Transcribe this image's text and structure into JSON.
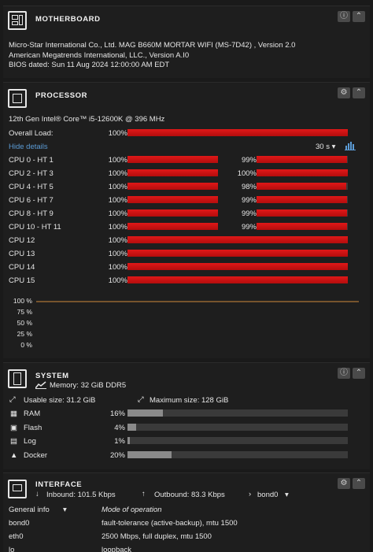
{
  "motherboard": {
    "title": "MOTHERBOARD",
    "line1": "Micro-Star International Co., Ltd. MAG B660M MORTAR WIFI (MS-7D42) , Version 2.0",
    "line2": "American Megatrends International, LLC., Version A.I0",
    "line3": "BIOS dated: Sun 11 Aug 2024 12:00:00 AM EDT"
  },
  "processor": {
    "title": "PROCESSOR",
    "model": "12th Gen Intel® Core™ i5-12600K @ 396 MHz",
    "overall_label": "Overall Load:",
    "overall_pct": "100%",
    "overall_value": 100,
    "hide_details": "Hide details",
    "interval": "30 s ▾",
    "cores": [
      {
        "label": "CPU 0 - HT 1",
        "pct": "100%",
        "value": 100,
        "ht_pct": "99%",
        "ht_value": 99
      },
      {
        "label": "CPU 2 - HT 3",
        "pct": "100%",
        "value": 100,
        "ht_pct": "100%",
        "ht_value": 100
      },
      {
        "label": "CPU 4 - HT 5",
        "pct": "100%",
        "value": 100,
        "ht_pct": "98%",
        "ht_value": 98
      },
      {
        "label": "CPU 6 - HT 7",
        "pct": "100%",
        "value": 100,
        "ht_pct": "99%",
        "ht_value": 99
      },
      {
        "label": "CPU 8 - HT 9",
        "pct": "100%",
        "value": 100,
        "ht_pct": "99%",
        "ht_value": 99
      },
      {
        "label": "CPU 10 - HT 11",
        "pct": "100%",
        "value": 100,
        "ht_pct": "99%",
        "ht_value": 99
      },
      {
        "label": "CPU 12",
        "pct": "100%",
        "value": 100
      },
      {
        "label": "CPU 13",
        "pct": "100%",
        "value": 100
      },
      {
        "label": "CPU 14",
        "pct": "100%",
        "value": 100
      },
      {
        "label": "CPU 15",
        "pct": "100%",
        "value": 100
      }
    ],
    "graph_axis": [
      "100 %",
      "75 %",
      "50 %",
      "25 %",
      "0 %"
    ],
    "graph_line_color": "#d08a3c"
  },
  "system": {
    "title": "SYSTEM",
    "memory": "Memory: 32 GiB DDR5",
    "usable": "Usable size: 31.2 GiB",
    "maximum": "Maximum size: 128 GiB",
    "items": [
      {
        "label": "RAM",
        "icon": "ram-icon",
        "pct": "16%",
        "value": 16
      },
      {
        "label": "Flash",
        "icon": "flash-icon",
        "pct": "4%",
        "value": 4
      },
      {
        "label": "Log",
        "icon": "log-icon",
        "pct": "1%",
        "value": 1
      },
      {
        "label": "Docker",
        "icon": "docker-icon",
        "pct": "20%",
        "value": 20
      }
    ]
  },
  "interface": {
    "title": "INTERFACE",
    "inbound": "Inbound: 101.5 Kbps",
    "outbound": "Outbound: 83.3 Kbps",
    "iface_select": "bond0",
    "info_select": "General info",
    "col_header": "Mode of operation",
    "rows": [
      {
        "name": "bond0",
        "value": "fault-tolerance (active-backup), mtu 1500"
      },
      {
        "name": "eth0",
        "value": "2500 Mbps, full duplex, mtu 1500"
      },
      {
        "name": "lo",
        "value": "loopback"
      }
    ]
  },
  "colors": {
    "bar_red": "#d01414",
    "bar_gray": "#8a8a8a",
    "link": "#5b9bd5"
  }
}
